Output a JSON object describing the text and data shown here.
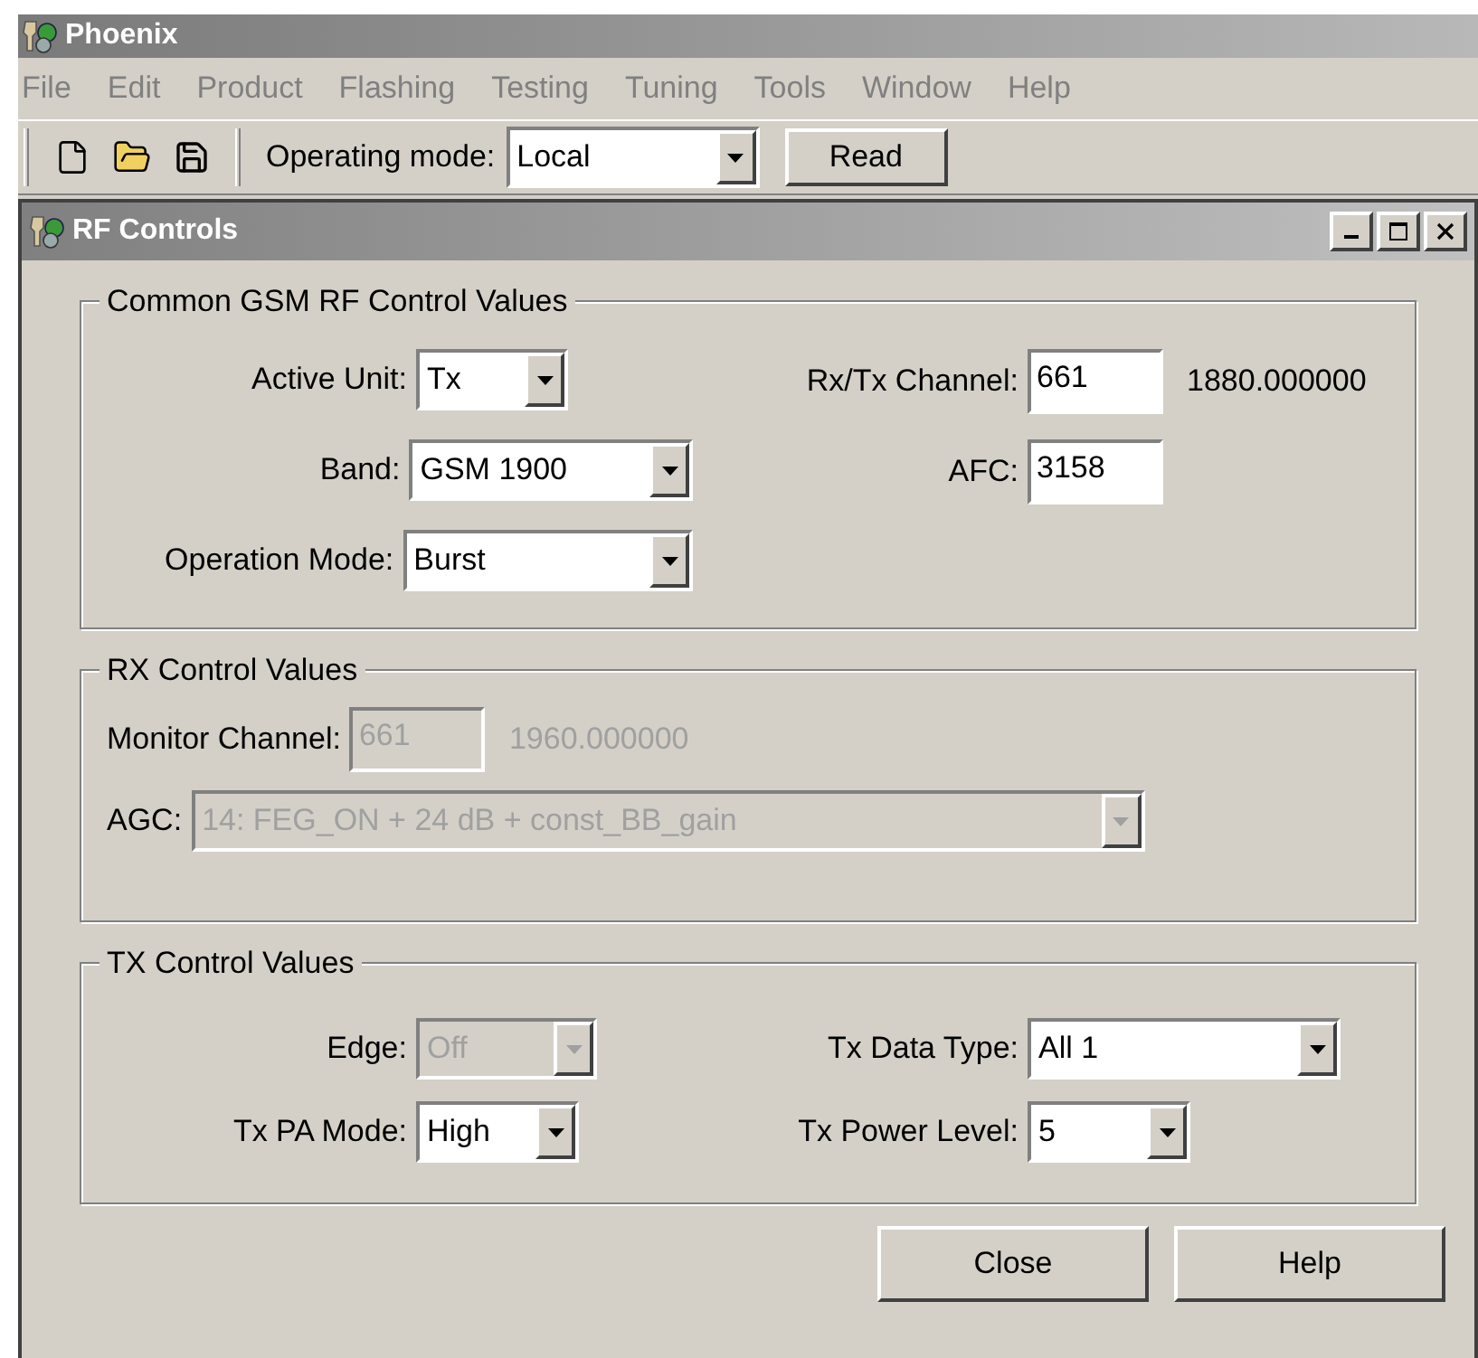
{
  "app": {
    "title": "Phoenix"
  },
  "menu": [
    "File",
    "Edit",
    "Product",
    "Flashing",
    "Testing",
    "Tuning",
    "Tools",
    "Window",
    "Help"
  ],
  "toolbar": {
    "mode_label": "Operating mode:",
    "mode_value": "Local",
    "read_button": "Read"
  },
  "window": {
    "title": "RF Controls"
  },
  "groups": [
    {
      "title": "Common GSM RF Control Values",
      "kind": "two-column",
      "rows": [
        [
          {
            "label": "Active Unit:",
            "kind": "combo",
            "value": "Tx",
            "disabled": false
          },
          {
            "label": "Rx/Tx Channel:",
            "kind": "edit",
            "value": "661",
            "disabled": false,
            "readout": "1880.000000"
          }
        ],
        [
          {
            "label": "Band:",
            "kind": "combo",
            "value": "GSM 1900",
            "disabled": false
          },
          {
            "label": "AFC:",
            "kind": "edit",
            "value": "3158",
            "disabled": false
          }
        ],
        [
          {
            "label": "Operation Mode:",
            "kind": "combo",
            "value": "Burst",
            "disabled": false
          }
        ]
      ]
    },
    {
      "title": "RX Control Values",
      "kind": "stacked",
      "rows": [
        [
          {
            "label": "Monitor Channel:",
            "kind": "edit",
            "value": "661",
            "disabled": true,
            "readout": "1960.000000"
          }
        ],
        [
          {
            "label": "AGC:",
            "kind": "combo",
            "value": "14: FEG_ON + 24 dB + const_BB_gain",
            "disabled": true
          }
        ]
      ]
    },
    {
      "title": "TX Control Values",
      "kind": "two-column",
      "rows": [
        [
          {
            "label": "Edge:",
            "kind": "combo",
            "value": "Off",
            "disabled": true
          },
          {
            "label": "Tx Data Type:",
            "kind": "combo",
            "value": "All 1",
            "disabled": false
          }
        ],
        [
          {
            "label": "Tx PA Mode:",
            "kind": "combo",
            "value": "High",
            "disabled": false
          },
          {
            "label": "Tx Power Level:",
            "kind": "combo",
            "value": "5",
            "disabled": false
          }
        ]
      ]
    }
  ],
  "buttons": [
    "Close",
    "Help"
  ]
}
